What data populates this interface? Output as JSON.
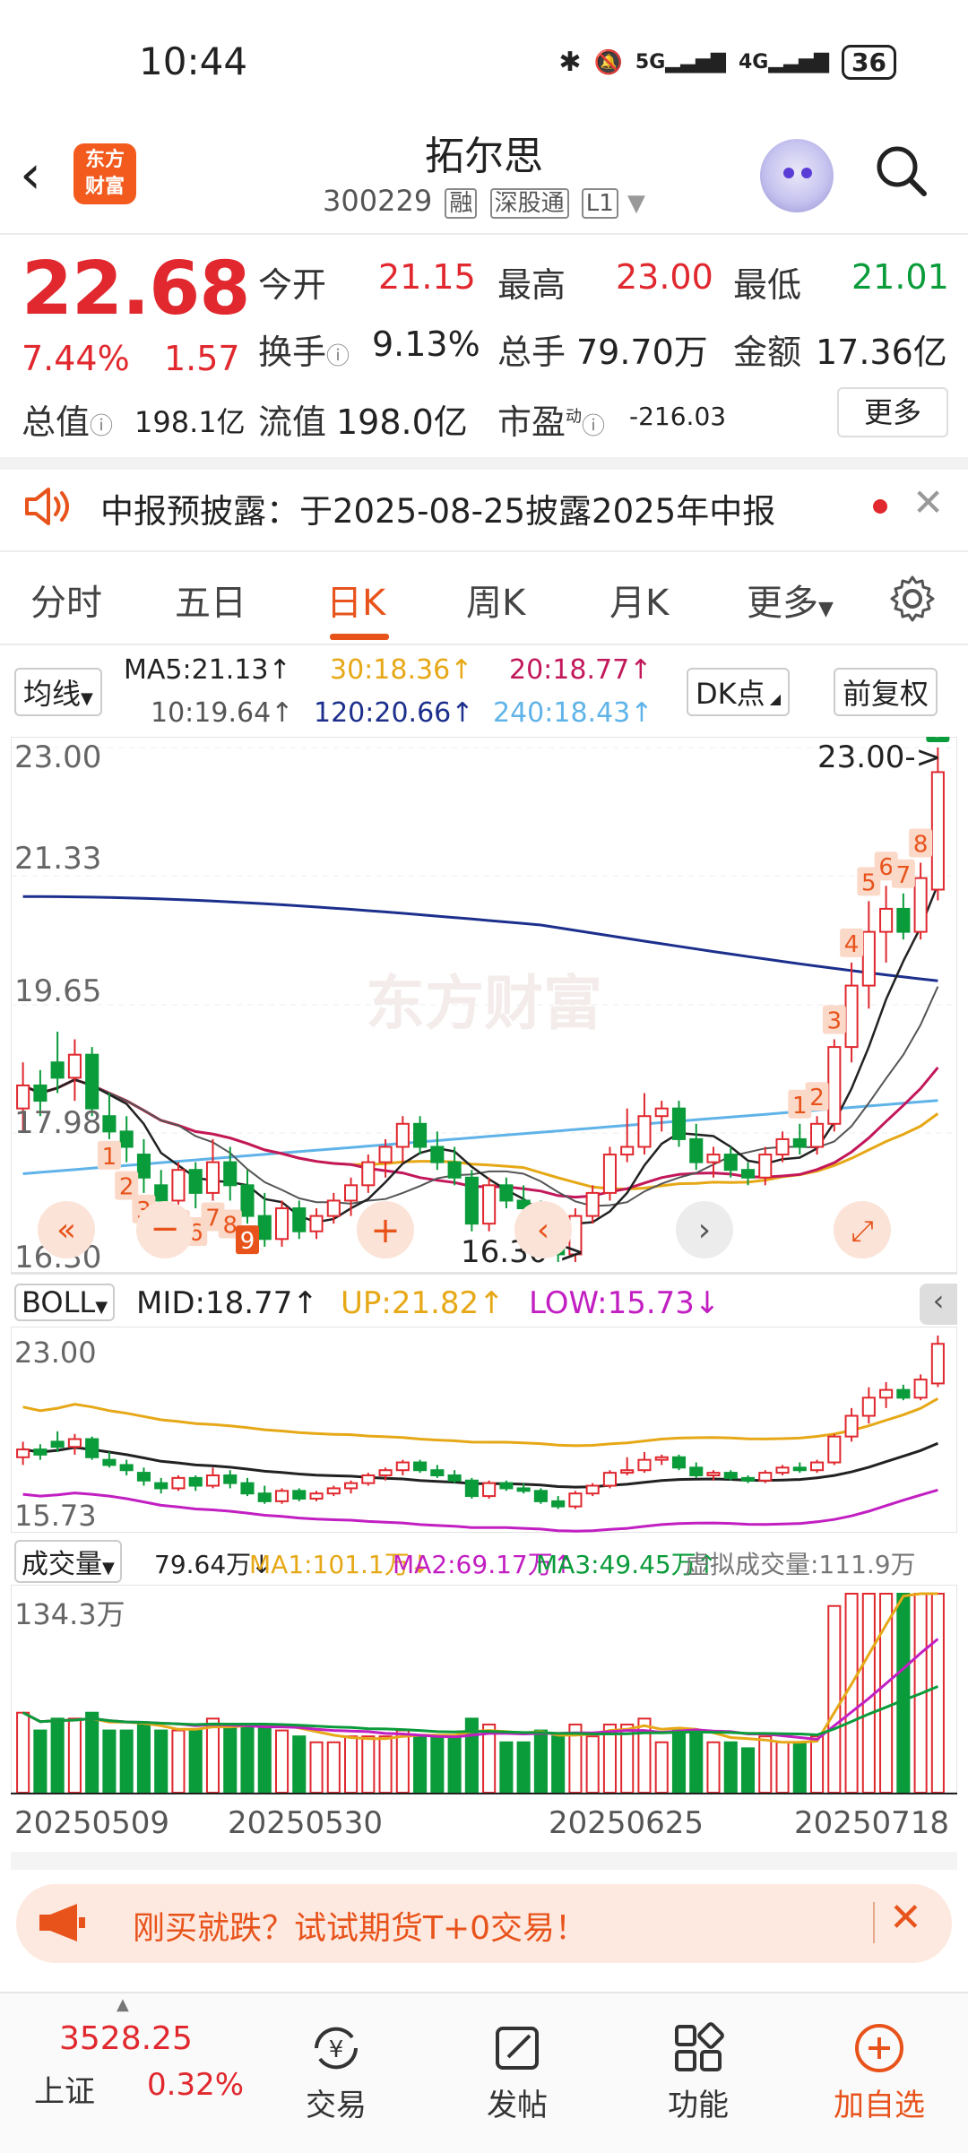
{
  "status": {
    "time": "10:44",
    "bt": "✱",
    "mute": "🔕",
    "net1": "5G",
    "net2": "4G",
    "battery": "36"
  },
  "header": {
    "name": "拓尔思",
    "code": "300229",
    "tags": [
      "融",
      "深股通",
      "L1"
    ],
    "logo_text": "东方\n财富"
  },
  "quote": {
    "price": "22.68",
    "pct": "7.44%",
    "change": "1.57",
    "open_label": "今开",
    "open": "21.15",
    "high_label": "最高",
    "high": "23.00",
    "low_label": "最低",
    "low": "21.01",
    "turnover_label": "换手",
    "turnover": "9.13%",
    "volume_label": "总手",
    "volume": "79.70万",
    "amount_label": "金额",
    "amount": "17.36亿",
    "mktcap_label": "总值",
    "mktcap": "198.1亿",
    "float_label": "流值",
    "float": "198.0亿",
    "pe_label": "市盈",
    "pe_sup": "动",
    "pe": "-216.03",
    "more": "更多"
  },
  "notice": {
    "text": "中报预披露：于2025-08-25披露2025年中报"
  },
  "tabs": [
    "分时",
    "五日",
    "日K",
    "周K",
    "月K",
    "更多"
  ],
  "ma_legend": {
    "selector": "均线",
    "ma5": "MA5:21.13↑",
    "ma30": "30:18.36↑",
    "ma20": "20:18.77↑",
    "ma10": "10:19.64↑",
    "ma120": "120:20.66↑",
    "ma240": "240:18.43↑",
    "dk": "DK点",
    "fq": "前复权"
  },
  "kchart": {
    "y_labels": [
      "23.00",
      "21.33",
      "19.65",
      "17.98",
      "16.30"
    ],
    "high_note": "23.00->",
    "low_note": "16.30->",
    "watermark": "东方财富",
    "td_marks": [
      "1",
      "2",
      "3",
      "4",
      "5",
      "6",
      "7",
      "8",
      "9"
    ]
  },
  "boll": {
    "selector": "BOLL",
    "mid": "MID:18.77↑",
    "up": "UP:21.82↑",
    "low": "LOW:15.73↓",
    "y_top": "23.00",
    "y_bottom": "15.73"
  },
  "vol": {
    "selector": "成交量",
    "v": "79.64万↓",
    "ma1": "MA1:101.1万↓",
    "ma2": "MA2:69.17万↑",
    "ma3": "MA3:49.45万↑",
    "virtual": "虚拟成交量:111.9万",
    "y_top": "134.3万"
  },
  "dates": [
    "20250509",
    "20250530",
    "20250625",
    "20250718"
  ],
  "banner": {
    "text": "刚买就跌？试试期货T+0交易！"
  },
  "nav": {
    "index_value": "3528.25",
    "index_name": "上证",
    "index_pct": "0.32%",
    "items": [
      "交易",
      "发帖",
      "功能",
      "加自选"
    ]
  },
  "colors": {
    "up": "#e0282e",
    "down": "#0a9b3a",
    "accent": "#e8531c",
    "ma5": "#222222",
    "ma10": "#555555",
    "ma20": "#c2185b",
    "ma30": "#e6a817",
    "ma120": "#1c2f8c",
    "ma240": "#5fb3e8"
  },
  "chart_data": {
    "type": "candlestick",
    "candles": [
      [
        18.3,
        18.9,
        18.0,
        18.6
      ],
      [
        18.6,
        18.8,
        18.2,
        18.4
      ],
      [
        18.9,
        19.3,
        18.5,
        18.7
      ],
      [
        18.7,
        19.2,
        18.4,
        19.0
      ],
      [
        19.0,
        19.1,
        18.2,
        18.3
      ],
      [
        18.2,
        18.5,
        17.9,
        18.0
      ],
      [
        18.0,
        18.2,
        17.6,
        17.8
      ],
      [
        17.7,
        17.9,
        17.2,
        17.4
      ],
      [
        17.3,
        17.5,
        16.9,
        17.1
      ],
      [
        17.1,
        17.6,
        17.0,
        17.5
      ],
      [
        17.5,
        17.6,
        17.0,
        17.2
      ],
      [
        17.2,
        17.9,
        17.1,
        17.6
      ],
      [
        17.6,
        17.8,
        17.1,
        17.3
      ],
      [
        17.3,
        17.5,
        16.8,
        16.9
      ],
      [
        16.9,
        17.2,
        16.5,
        16.6
      ],
      [
        16.6,
        17.1,
        16.5,
        17.0
      ],
      [
        17.0,
        17.1,
        16.6,
        16.7
      ],
      [
        16.7,
        17.0,
        16.6,
        16.9
      ],
      [
        16.9,
        17.2,
        16.8,
        17.1
      ],
      [
        17.1,
        17.4,
        16.9,
        17.3
      ],
      [
        17.3,
        17.7,
        17.2,
        17.6
      ],
      [
        17.6,
        17.9,
        17.4,
        17.8
      ],
      [
        17.8,
        18.2,
        17.6,
        18.1
      ],
      [
        18.1,
        18.2,
        17.7,
        17.8
      ],
      [
        17.8,
        18.0,
        17.5,
        17.6
      ],
      [
        17.6,
        17.8,
        17.3,
        17.4
      ],
      [
        17.4,
        17.5,
        16.7,
        16.8
      ],
      [
        16.8,
        17.4,
        16.7,
        17.3
      ],
      [
        17.3,
        17.4,
        17.0,
        17.1
      ],
      [
        17.1,
        17.3,
        16.9,
        17.0
      ],
      [
        17.0,
        17.1,
        16.5,
        16.6
      ],
      [
        16.6,
        16.8,
        16.3,
        16.4
      ],
      [
        16.4,
        17.0,
        16.3,
        16.9
      ],
      [
        16.9,
        17.3,
        16.8,
        17.2
      ],
      [
        17.2,
        17.8,
        17.1,
        17.7
      ],
      [
        17.7,
        18.3,
        17.6,
        17.8
      ],
      [
        17.8,
        18.5,
        17.7,
        18.2
      ],
      [
        18.2,
        18.4,
        18.0,
        18.3
      ],
      [
        18.3,
        18.4,
        17.8,
        17.9
      ],
      [
        17.9,
        18.1,
        17.5,
        17.6
      ],
      [
        17.6,
        17.8,
        17.4,
        17.7
      ],
      [
        17.7,
        17.8,
        17.4,
        17.5
      ],
      [
        17.5,
        17.6,
        17.3,
        17.4
      ],
      [
        17.4,
        17.8,
        17.3,
        17.7
      ],
      [
        17.7,
        18.0,
        17.6,
        17.9
      ],
      [
        17.9,
        18.1,
        17.7,
        17.8
      ],
      [
        17.8,
        18.2,
        17.7,
        18.1
      ],
      [
        18.1,
        19.2,
        18.0,
        19.1
      ],
      [
        19.1,
        20.2,
        18.9,
        19.9
      ],
      [
        19.9,
        21.0,
        19.6,
        20.6
      ],
      [
        20.6,
        21.2,
        20.2,
        20.9
      ],
      [
        20.9,
        21.1,
        20.5,
        20.6
      ],
      [
        20.6,
        21.5,
        20.5,
        21.3
      ],
      [
        21.15,
        23.0,
        21.01,
        22.68
      ]
    ]
  }
}
